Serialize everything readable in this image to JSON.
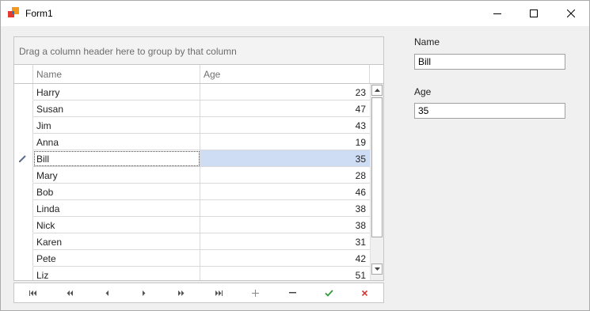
{
  "window": {
    "title": "Form1"
  },
  "grid": {
    "group_panel_text": "Drag a column header here to group by that column",
    "columns": [
      "Name",
      "Age"
    ],
    "rows": [
      {
        "name": "Harry",
        "age": "23"
      },
      {
        "name": "Susan",
        "age": "47"
      },
      {
        "name": "Jim",
        "age": "43"
      },
      {
        "name": "Anna",
        "age": "19"
      },
      {
        "name": "Bill",
        "age": "35"
      },
      {
        "name": "Mary",
        "age": "28"
      },
      {
        "name": "Bob",
        "age": "46"
      },
      {
        "name": "Linda",
        "age": "38"
      },
      {
        "name": "Nick",
        "age": "38"
      },
      {
        "name": "Karen",
        "age": "31"
      },
      {
        "name": "Pete",
        "age": "42"
      },
      {
        "name": "Liz",
        "age": "51"
      }
    ],
    "focused_row_index": 4,
    "focused_row_indicator": "pencil-icon",
    "focused_color": "#cfddf4"
  },
  "navigator": {
    "buttons": [
      "first-icon",
      "prev-page-icon",
      "prev-icon",
      "next-icon",
      "next-page-icon",
      "last-icon",
      "append-icon",
      "remove-icon",
      "end-edit-icon",
      "cancel-edit-icon"
    ]
  },
  "form": {
    "name_label": "Name",
    "name_value": "Bill",
    "age_label": "Age",
    "age_value": "35"
  }
}
